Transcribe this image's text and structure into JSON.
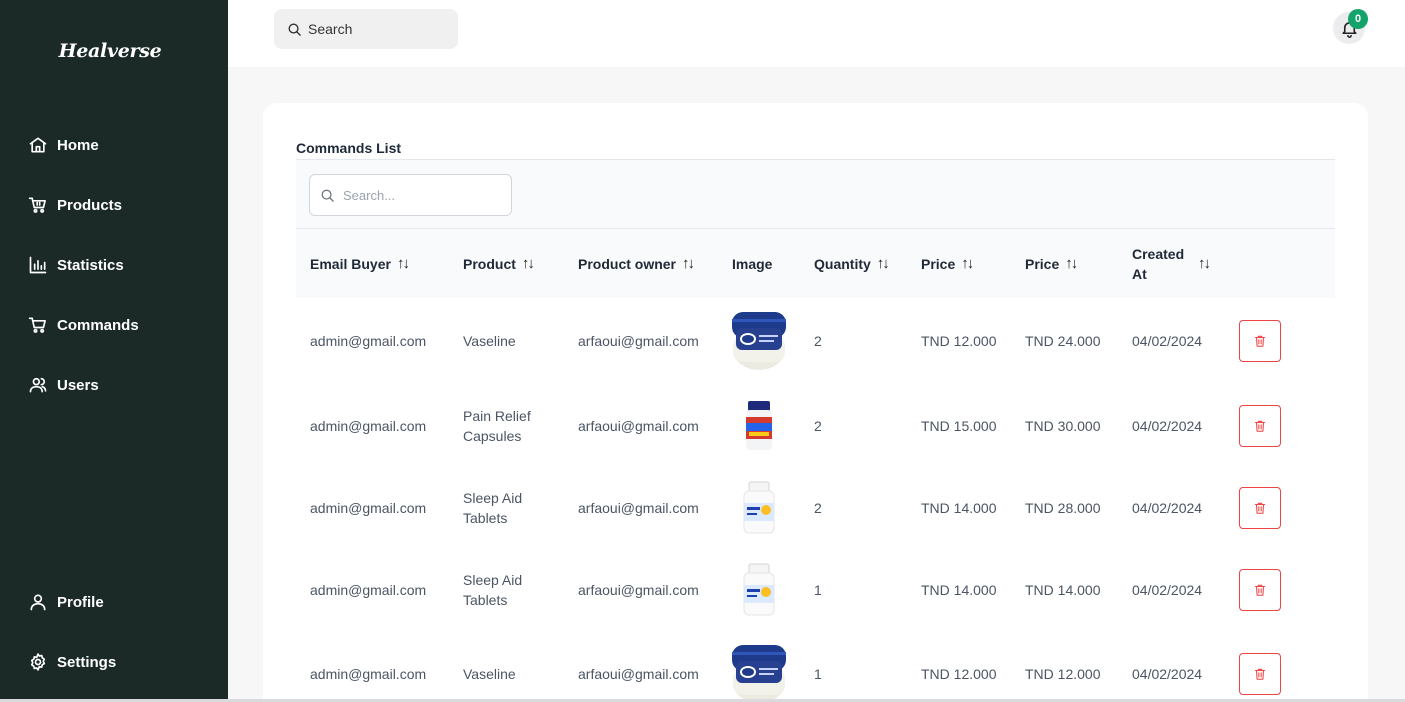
{
  "app": {
    "brand": "Healverse"
  },
  "sidebar": {
    "items": [
      {
        "label": "Home",
        "icon": "home-icon"
      },
      {
        "label": "Products",
        "icon": "cart-icon"
      },
      {
        "label": "Statistics",
        "icon": "chart-icon"
      },
      {
        "label": "Commands",
        "icon": "cart-icon"
      },
      {
        "label": "Users",
        "icon": "users-icon"
      }
    ],
    "bottom_items": [
      {
        "label": "Profile",
        "icon": "user-icon"
      },
      {
        "label": "Settings",
        "icon": "gear-icon"
      }
    ]
  },
  "topbar": {
    "search_placeholder": "Search",
    "notification_count": "0"
  },
  "main": {
    "title": "Commands List",
    "table_search_placeholder": "Search...",
    "columns": [
      "Email Buyer",
      "Product",
      "Product owner",
      "Image",
      "Quantity",
      "Price",
      "Price",
      "Created At"
    ],
    "rows": [
      {
        "email": "admin@gmail.com",
        "product": "Vaseline",
        "owner": "arfaoui@gmail.com",
        "image": "vaseline-jar",
        "quantity": "2",
        "price": "TND 12.000",
        "total": "TND 24.000",
        "created": "04/02/2024"
      },
      {
        "email": "admin@gmail.com",
        "product": "Pain Relief Capsules",
        "owner": "arfaoui@gmail.com",
        "image": "capsule-bottle",
        "quantity": "2",
        "price": "TND 15.000",
        "total": "TND 30.000",
        "created": "04/02/2024"
      },
      {
        "email": "admin@gmail.com",
        "product": "Sleep Aid Tablets",
        "owner": "arfaoui@gmail.com",
        "image": "tablet-bottle",
        "quantity": "2",
        "price": "TND 14.000",
        "total": "TND 28.000",
        "created": "04/02/2024"
      },
      {
        "email": "admin@gmail.com",
        "product": "Sleep Aid Tablets",
        "owner": "arfaoui@gmail.com",
        "image": "tablet-bottle",
        "quantity": "1",
        "price": "TND 14.000",
        "total": "TND 14.000",
        "created": "04/02/2024"
      },
      {
        "email": "admin@gmail.com",
        "product": "Vaseline",
        "owner": "arfaoui@gmail.com",
        "image": "vaseline-jar",
        "quantity": "1",
        "price": "TND 12.000",
        "total": "TND 12.000",
        "created": "04/02/2024"
      }
    ]
  },
  "colors": {
    "sidebar_bg": "#1b2a27",
    "badge": "#13a36b",
    "delete": "#ef4444"
  }
}
